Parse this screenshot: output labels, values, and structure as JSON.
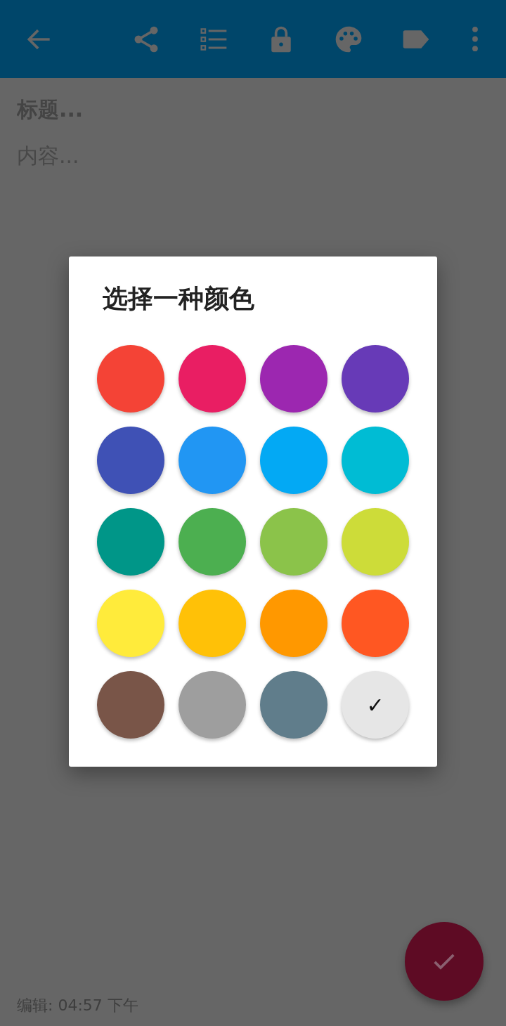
{
  "note": {
    "title": {
      "placeholder": "标题..."
    },
    "content": {
      "placeholder": "内容..."
    }
  },
  "dialog": {
    "title": "选择一种颜色",
    "selected_mark": "✓",
    "swatches": [
      {
        "color": "#f44336",
        "selected": false
      },
      {
        "color": "#e91e63",
        "selected": false
      },
      {
        "color": "#9c27b0",
        "selected": false
      },
      {
        "color": "#673ab7",
        "selected": false
      },
      {
        "color": "#3f51b5",
        "selected": false
      },
      {
        "color": "#2196f3",
        "selected": false
      },
      {
        "color": "#03a9f4",
        "selected": false
      },
      {
        "color": "#00bcd4",
        "selected": false
      },
      {
        "color": "#009688",
        "selected": false
      },
      {
        "color": "#4caf50",
        "selected": false
      },
      {
        "color": "#8bc34a",
        "selected": false
      },
      {
        "color": "#cddc39",
        "selected": false
      },
      {
        "color": "#ffeb3b",
        "selected": false
      },
      {
        "color": "#ffc107",
        "selected": false
      },
      {
        "color": "#ff9800",
        "selected": false
      },
      {
        "color": "#ff5722",
        "selected": false
      },
      {
        "color": "#795548",
        "selected": false
      },
      {
        "color": "#9e9e9e",
        "selected": false
      },
      {
        "color": "#607d8b",
        "selected": false
      },
      {
        "color": "#e6e6e6",
        "selected": true
      }
    ]
  },
  "footer": {
    "edited": "编辑: 04:57 下午"
  }
}
